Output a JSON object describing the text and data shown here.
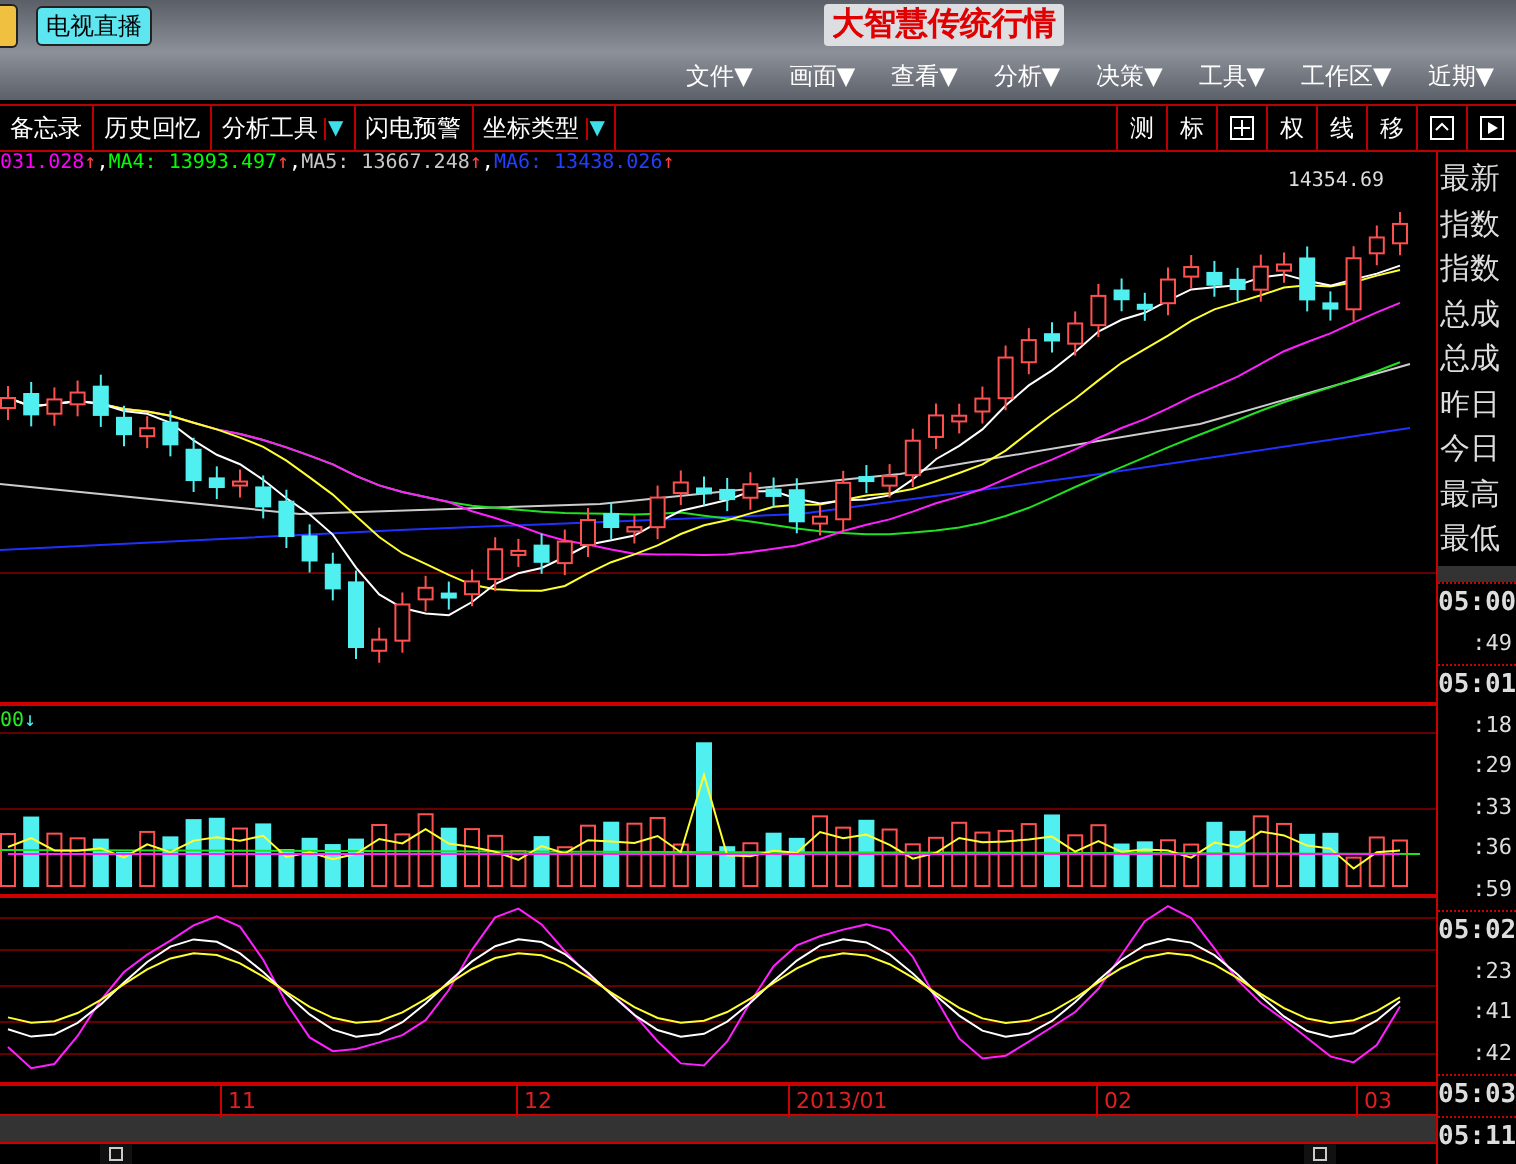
{
  "window": {
    "title": "大智慧传统行情"
  },
  "top_buttons": [
    {
      "label": "电视直播"
    }
  ],
  "menu": [
    {
      "label": "文件▼"
    },
    {
      "label": "画面▼"
    },
    {
      "label": "查看▼"
    },
    {
      "label": "分析▼"
    },
    {
      "label": "决策▼"
    },
    {
      "label": "工具▼"
    },
    {
      "label": "工作区▼"
    },
    {
      "label": "近期▼"
    }
  ],
  "toolbar": [
    {
      "label": "备忘录"
    },
    {
      "label": "历史回忆"
    },
    {
      "label": "分析工具",
      "dropdown": "▼"
    },
    {
      "label": "闪电预警"
    },
    {
      "label": "坐标类型",
      "dropdown": "▼"
    }
  ],
  "tools": [
    {
      "kind": "text",
      "label": "测"
    },
    {
      "kind": "text",
      "label": "标"
    },
    {
      "kind": "grid"
    },
    {
      "kind": "text",
      "label": "权"
    },
    {
      "kind": "text",
      "label": "线"
    },
    {
      "kind": "text",
      "label": "移"
    },
    {
      "kind": "window"
    },
    {
      "kind": "play"
    }
  ],
  "ma_legend": [
    {
      "text": "031.028",
      "arrow": "↑",
      "separator": ",",
      "color": "#ff00ff"
    },
    {
      "text": "MA4: 13993.497",
      "arrow": "↑",
      "separator": ",",
      "color": "#00ff00"
    },
    {
      "text": "MA5: 13667.248",
      "arrow": "↑",
      "separator": ",",
      "color": "#c8c8c8"
    },
    {
      "text": "MA6: 13438.026",
      "arrow": "↑",
      "color": "#2040ff"
    }
  ],
  "price_label": "14354.69",
  "volume_label": {
    "text": "00",
    "arrow": "↓"
  },
  "x_axis": [
    "11",
    "12",
    "2013/01",
    "02",
    "03"
  ],
  "info_labels": [
    "最新",
    "指数",
    "指数",
    "总成",
    "总成",
    "昨日",
    "今日",
    "最高",
    "最低"
  ],
  "times": [
    {
      "kind": "minute",
      "text": "05:00"
    },
    {
      "kind": "second",
      "text": ":49"
    },
    {
      "kind": "minute",
      "text": "05:01"
    },
    {
      "kind": "second",
      "text": ":18"
    },
    {
      "kind": "second",
      "text": ":29"
    },
    {
      "kind": "second",
      "text": ":33"
    },
    {
      "kind": "second",
      "text": ":36"
    },
    {
      "kind": "second",
      "text": ":59"
    },
    {
      "kind": "minute",
      "text": "05:02"
    },
    {
      "kind": "second",
      "text": ":23"
    },
    {
      "kind": "second",
      "text": ":41"
    },
    {
      "kind": "second",
      "text": ":42"
    },
    {
      "kind": "minute",
      "text": "05:03"
    },
    {
      "kind": "minute",
      "text": "05:11"
    }
  ]
}
